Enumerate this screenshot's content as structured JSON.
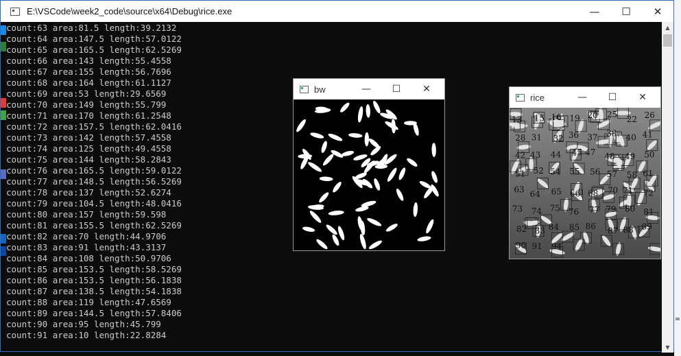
{
  "console": {
    "title": "E:\\VSCode\\week2_code\\source\\x64\\Debug\\rice.exe",
    "lines": [
      "count:63 area:81.5 length:39.2132",
      "count:64 area:147.5 length:57.0122",
      "count:65 area:165.5 length:62.5269",
      "count:66 area:143 length:55.4558",
      "count:67 area:155 length:56.7696",
      "count:68 area:164 length:61.1127",
      "count:69 area:53 length:29.6569",
      "count:70 area:149 length:55.799",
      "count:71 area:170 length:61.2548",
      "count:72 area:157.5 length:62.0416",
      "count:73 area:142 length:57.4558",
      "count:74 area:125 length:49.4558",
      "count:75 area:144 length:58.2843",
      "count:76 area:165.5 length:59.0122",
      "count:77 area:148.5 length:56.5269",
      "count:78 area:137 length:52.6274",
      "count:79 area:104.5 length:48.0416",
      "count:80 area:157 length:59.598",
      "count:81 area:155.5 length:62.5269",
      "count:82 area:70 length:44.9706",
      "count:83 area:91 length:43.3137",
      "count:84 area:108 length:50.9706",
      "count:85 area:153.5 length:58.5269",
      "count:86 area:153.5 length:56.1838",
      "count:87 area:138.5 length:54.1838",
      "count:88 area:119 length:47.6569",
      "count:89 area:144.5 length:57.8406",
      "count:90 area:95 length:45.799",
      "count:91 area:10 length:22.8284"
    ]
  },
  "window_buttons": {
    "minimize": "—",
    "maximize": "☐",
    "close": "✕"
  },
  "bw_window": {
    "title": "bw"
  },
  "rice_window": {
    "title": "rice",
    "labels": [
      "13",
      "15",
      "16",
      "19",
      "20",
      "25",
      "22",
      "26",
      "28",
      "31",
      "32",
      "36",
      "37",
      "38",
      "40",
      "41",
      "42",
      "43",
      "44",
      "45",
      "47",
      "48",
      "49",
      "50",
      "51",
      "52",
      "54",
      "55",
      "56",
      "57",
      "58",
      "61",
      "63",
      "64",
      "65",
      "66",
      "68",
      "70",
      "71",
      "72",
      "73",
      "74",
      "75",
      "76",
      "77",
      "79",
      "80",
      "81",
      "82",
      "83",
      "84",
      "85",
      "86",
      "87",
      "88",
      "89",
      "90",
      "91",
      "94"
    ]
  }
}
